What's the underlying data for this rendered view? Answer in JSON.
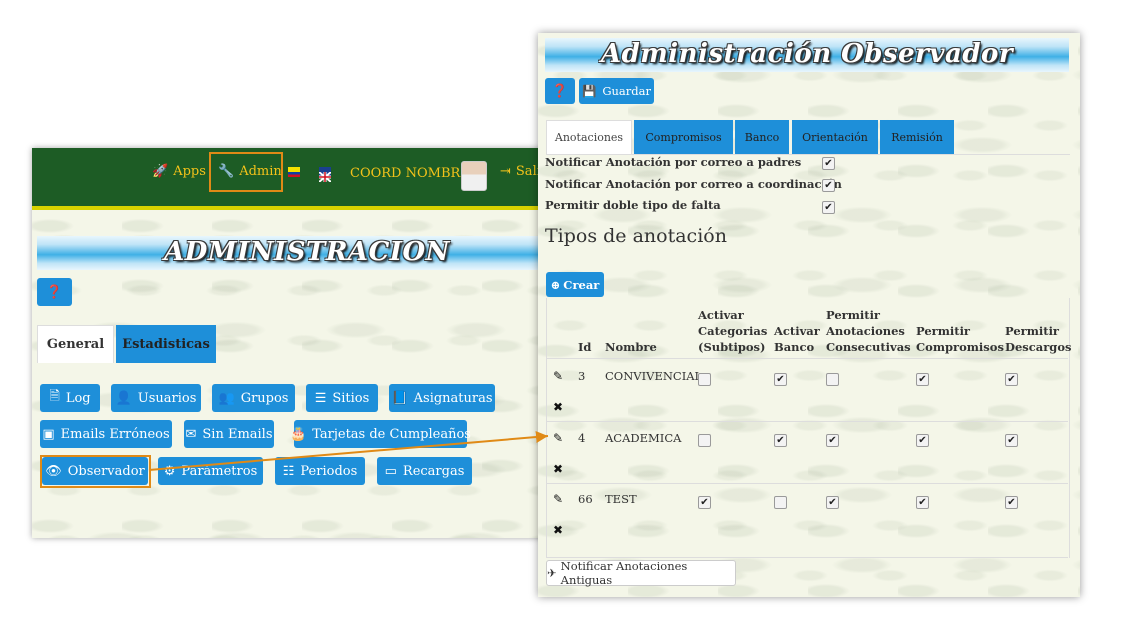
{
  "left_window": {
    "nav": {
      "apps": "Apps",
      "admin": "Admin",
      "user": "COORD NOMBRES",
      "exit": "Sali"
    },
    "title": "ADMINISTRACION",
    "tabs": [
      "General",
      "Estadisticas"
    ],
    "buttons": {
      "log": "Log",
      "usuarios": "Usuarios",
      "grupos": "Grupos",
      "sitios": "Sitios",
      "asignaturas": "Asignaturas",
      "emails_erroneos": "Emails Erróneos",
      "sin_emails": "Sin Emails",
      "tarjetas": "Tarjetas de Cumpleaños",
      "observador": "Observador",
      "parametros": "Parámetros",
      "periodos": "Periodos",
      "recargas": "Recargas"
    }
  },
  "right_window": {
    "title": "Administración Observador",
    "toolbar": {
      "save_label": "Guardar"
    },
    "tabs": [
      "Anotaciones",
      "Compromisos",
      "Banco",
      "Orientación",
      "Remisión"
    ],
    "settings": [
      {
        "label": "Notificar Anotación por correo a padres",
        "checked": true
      },
      {
        "label": "Notificar Anotación por correo a coordinación",
        "checked": true
      },
      {
        "label": "Permitir doble tipo de falta",
        "checked": true
      }
    ],
    "section_title": "Tipos de anotación",
    "create_label": "Crear",
    "table": {
      "headers": {
        "id": "Id",
        "nombre": "Nombre",
        "cat_1": "Activar",
        "cat_2": "Categorias",
        "cat_3": "(Subtipos)",
        "banco_1": "Activar",
        "banco_2": "Banco",
        "consec_1": "Permitir",
        "consec_2": "Anotaciones",
        "consec_3": "Consecutivas",
        "comp_1": "Permitir",
        "comp_2": "Compromisos",
        "desc_1": "Permitir",
        "desc_2": "Descargos"
      },
      "rows": [
        {
          "id": "3",
          "nombre": "CONVIVENCIAL",
          "categorias": false,
          "banco": true,
          "consecutivas": false,
          "compromisos": true,
          "descargos": true
        },
        {
          "id": "4",
          "nombre": "ACADEMICA",
          "categorias": false,
          "banco": true,
          "consecutivas": true,
          "compromisos": true,
          "descargos": true
        },
        {
          "id": "66",
          "nombre": "TEST",
          "categorias": true,
          "banco": false,
          "consecutivas": true,
          "compromisos": true,
          "descargos": true
        }
      ]
    },
    "notify_old_label": "Notificar Anotaciones Antiguas"
  },
  "colors": {
    "topbar": "#1d5c25",
    "accent": "#1e8fd9",
    "highlight": "#e08a16",
    "nav_text": "#f3c21a"
  }
}
